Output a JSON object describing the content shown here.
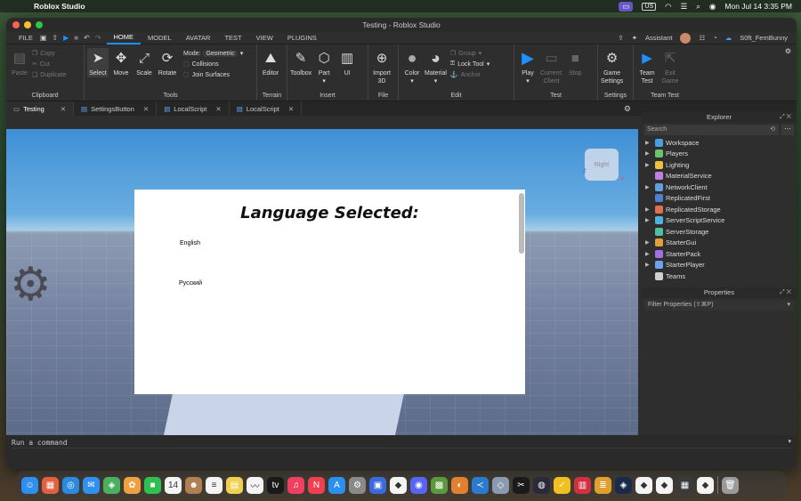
{
  "menubar": {
    "app_name": "Roblox Studio",
    "input_source": "US",
    "datetime": "Mon Jul 14  3:35 PM"
  },
  "window": {
    "title": "Testing - Roblox Studio"
  },
  "ribbon_tabs": {
    "file": "FILE",
    "tabs": [
      "HOME",
      "MODEL",
      "AVATAR",
      "TEST",
      "VIEW",
      "PLUGINS"
    ],
    "assistant": "Assistant",
    "username": "S0ft_FemBunny"
  },
  "ribbon": {
    "clipboard": {
      "label": "Clipboard",
      "paste": "Paste",
      "copy": "Copy",
      "cut": "Cut",
      "duplicate": "Duplicate"
    },
    "tools": {
      "label": "Tools",
      "select": "Select",
      "move": "Move",
      "scale": "Scale",
      "rotate": "Rotate",
      "mode_label": "Mode:",
      "mode_value": "Geometric",
      "collisions": "Collisions",
      "join_surfaces": "Join Surfaces"
    },
    "terrain": {
      "label": "Terrain",
      "editor": "Editor"
    },
    "insert": {
      "label": "Insert",
      "toolbox": "Toolbox",
      "part": "Part",
      "ui": "UI"
    },
    "file": {
      "label": "File",
      "import3d_line1": "Import",
      "import3d_line2": "3D"
    },
    "edit": {
      "label": "Edit",
      "color": "Color",
      "material": "Material",
      "group": "Group",
      "lock_tool": "Lock Tool",
      "anchor": "Anchor"
    },
    "test": {
      "label": "Test",
      "play": "Play",
      "current_line1": "Current:",
      "current_line2": "Client",
      "stop": "Stop"
    },
    "settings": {
      "label": "Settings",
      "game_line1": "Game",
      "game_line2": "Settings"
    },
    "team_test": {
      "label": "Team Test",
      "team_line1": "Team",
      "team_line2": "Test",
      "exit_line1": "Exit",
      "exit_line2": "Game"
    }
  },
  "doc_tabs": [
    "Testing",
    "SettingsButton",
    "LocalScript",
    "LocalScript"
  ],
  "viewport": {
    "gui_title": "Language Selected:",
    "options": [
      "English",
      "Русский"
    ],
    "view_cube_label": "Right",
    "axis_z": "Z",
    "axis_x": "X"
  },
  "explorer": {
    "title": "Explorer",
    "search_placeholder": "Search",
    "items": [
      {
        "name": "Workspace",
        "expandable": true,
        "color": "#4a9fe0"
      },
      {
        "name": "Players",
        "expandable": true,
        "color": "#6bc46b"
      },
      {
        "name": "Lighting",
        "expandable": true,
        "color": "#f0c040"
      },
      {
        "name": "MaterialService",
        "expandable": false,
        "color": "#c080e0"
      },
      {
        "name": "NetworkClient",
        "expandable": true,
        "color": "#60a0e0"
      },
      {
        "name": "ReplicatedFirst",
        "expandable": false,
        "color": "#5080d0"
      },
      {
        "name": "ReplicatedStorage",
        "expandable": true,
        "color": "#e07050"
      },
      {
        "name": "ServerScriptService",
        "expandable": true,
        "color": "#50b0e0"
      },
      {
        "name": "ServerStorage",
        "expandable": false,
        "color": "#50c0a0"
      },
      {
        "name": "StarterGui",
        "expandable": true,
        "color": "#e0a040"
      },
      {
        "name": "StarterPack",
        "expandable": true,
        "color": "#a070e0"
      },
      {
        "name": "StarterPlayer",
        "expandable": true,
        "color": "#70a0f0"
      },
      {
        "name": "Teams",
        "expandable": false,
        "color": "#d0d0d0"
      }
    ]
  },
  "properties": {
    "title": "Properties",
    "filter_placeholder": "Filter Properties (⇧⌘P)"
  },
  "command_bar": {
    "placeholder": "Run a command"
  },
  "dock": {
    "icons": [
      {
        "name": "finder-icon",
        "color": "#2f8ff0",
        "glyph": "☺"
      },
      {
        "name": "launchpad-icon",
        "color": "#e06040",
        "glyph": "▦"
      },
      {
        "name": "safari-icon",
        "color": "#2a8ae0",
        "glyph": "◎"
      },
      {
        "name": "mail-icon",
        "color": "#3090f0",
        "glyph": "✉"
      },
      {
        "name": "maps-icon",
        "color": "#4ab060",
        "glyph": "◈"
      },
      {
        "name": "photos-icon",
        "color": "#f0a040",
        "glyph": "✿"
      },
      {
        "name": "facetime-icon",
        "color": "#30c050",
        "glyph": "■"
      },
      {
        "name": "calendar-icon",
        "color": "#f4f4f4",
        "glyph": "14"
      },
      {
        "name": "contacts-icon",
        "color": "#b08050",
        "glyph": "☻"
      },
      {
        "name": "reminders-icon",
        "color": "#f4f4f4",
        "glyph": "≡"
      },
      {
        "name": "notes-icon",
        "color": "#f0d050",
        "glyph": "▤"
      },
      {
        "name": "freeform-icon",
        "color": "#f4f4f4",
        "glyph": "〰"
      },
      {
        "name": "tv-icon",
        "color": "#1a1a1a",
        "glyph": "tv"
      },
      {
        "name": "music-icon",
        "color": "#f04060",
        "glyph": "♫"
      },
      {
        "name": "news-icon",
        "color": "#f04050",
        "glyph": "N"
      },
      {
        "name": "appstore-icon",
        "color": "#2a90f0",
        "glyph": "A"
      },
      {
        "name": "settings-icon",
        "color": "#8a8a8a",
        "glyph": "⚙"
      },
      {
        "name": "screen-sharing-icon",
        "color": "#3a6ae0",
        "glyph": "▣"
      },
      {
        "name": "roblox-icon",
        "color": "#f4f4f4",
        "glyph": "◆"
      },
      {
        "name": "discord-icon",
        "color": "#5865f2",
        "glyph": "◉"
      },
      {
        "name": "minecraft-icon",
        "color": "#5a9a3a",
        "glyph": "▩"
      },
      {
        "name": "blender-icon",
        "color": "#e08030",
        "glyph": "◐"
      },
      {
        "name": "vscode-icon",
        "color": "#2a7ad0",
        "glyph": "≺"
      },
      {
        "name": "unity-icon",
        "color": "#8a9ab0",
        "glyph": "◇"
      },
      {
        "name": "capcut-icon",
        "color": "#1a1a1a",
        "glyph": "✂"
      },
      {
        "name": "obs-icon",
        "color": "#2a2a3a",
        "glyph": "◍"
      },
      {
        "name": "norton-icon",
        "color": "#f0c020",
        "glyph": "✓"
      },
      {
        "name": "photo-booth-icon",
        "color": "#d03040",
        "glyph": "▥"
      },
      {
        "name": "stack-icon",
        "color": "#e0a030",
        "glyph": "≣"
      },
      {
        "name": "roblox-studio-icon",
        "color": "#1a2a4a",
        "glyph": "◈"
      },
      {
        "name": "roblox-player-icon",
        "color": "#f4f4f4",
        "glyph": "◆"
      },
      {
        "name": "roblox-player-2-icon",
        "color": "#f4f4f4",
        "glyph": "◆"
      },
      {
        "name": "calculator-icon",
        "color": "#3a3a3a",
        "glyph": "▦"
      },
      {
        "name": "roblox-3-icon",
        "color": "#f4f4f4",
        "glyph": "◆"
      },
      {
        "name": "trash-icon",
        "color": "#9a9a9a",
        "glyph": "🗑"
      }
    ]
  }
}
